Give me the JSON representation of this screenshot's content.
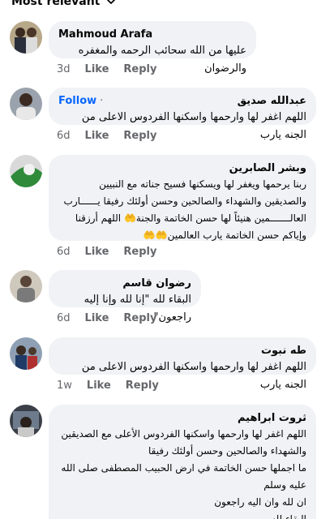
{
  "sort": {
    "label": "Most relevant"
  },
  "comments": [
    {
      "author": "Mahmoud Arafa",
      "text": "عليها من الله سحائب الرحمه والمغفره والرضوان",
      "time": "3d",
      "like": "Like",
      "reply": "Reply"
    },
    {
      "follow": "Follow",
      "author": "عبدالله صديق",
      "text": "اللهم اغفر لها وارحمها واسكنها الفردوس الاعلى من الجنه يارب",
      "time": "6d",
      "like": "Like",
      "reply": "Reply"
    },
    {
      "author": "وبشر الصابرين",
      "text": "ربنا يرحمها ويغفر لها ويسكنها فسيح جناته مع النبيين\nوالصديقين والشهداء والصالحين وحسن أولئك رفيقا يــــــارب\nالعالـــــــمين هنيئاً لها حسن الخاتمة والجنة🤲 اللهم أرزقنا\nوإياكم حسن الخاتمة يارب العالمين🤲🤲",
      "time": "6d",
      "like": "Like",
      "reply": "Reply"
    },
    {
      "author": "رضوان قاسم",
      "text": "البقاء لله \"إنا لله وإنا إليه راجعون\"",
      "time": "6d",
      "like": "Like",
      "reply": "Reply"
    },
    {
      "author": "طه نبوت",
      "text": "اللهم اغفر لها وارحمها واسكنها الفردوس الاعلى من الجنه يارب",
      "time": "1w",
      "like": "Like",
      "reply": "Reply"
    },
    {
      "author": "ثروت ابراهيم",
      "text": "اللهم اغفر لها وارحمها واسكنها الفردوس الأعلى مع الصديقين\nوالشهداء والصالحين وحسن أولئك رفيقا\nما اجملها حسن الخاتمة في ارض الحبيب المصطفى صلى الله\nعليه وسلم\nان لله وان اليه راجعون\nالبقاء لله"
    }
  ],
  "icons": [
    "chevron-down-icon"
  ],
  "colors": {
    "bubble": "#f0f2f5",
    "follow": "#0866ff",
    "meta": "#65676b"
  }
}
